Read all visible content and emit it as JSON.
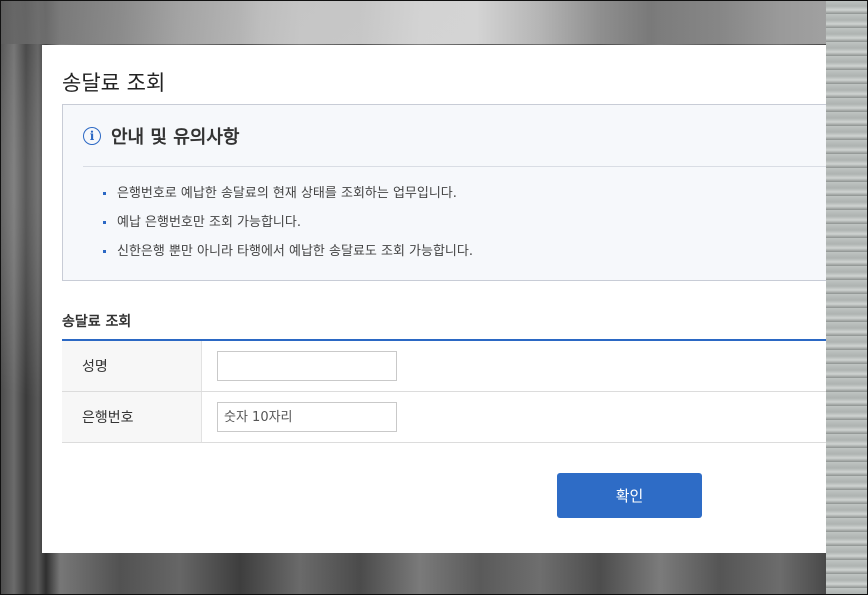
{
  "dialog": {
    "title": "송달료 조회"
  },
  "notice": {
    "icon": "info-icon",
    "title": "안내 및 유의사항",
    "items": [
      "은행번호로 예납한 송달료의 현재 상태를 조회하는 업무입니다.",
      "예납 은행번호만 조회 가능합니다.",
      "신한은행 뿐만 아니라 타행에서 예납한 송달료도 조회 가능합니다."
    ]
  },
  "form": {
    "section_title": "송달료 조회",
    "name_label": "성명",
    "name_value": "",
    "bank_label": "은행번호",
    "bank_placeholder": "숫자 10자리",
    "confirm_label": "확인"
  },
  "colors": {
    "accent": "#2e6cc6",
    "notice_bg": "#f6f8fb"
  }
}
